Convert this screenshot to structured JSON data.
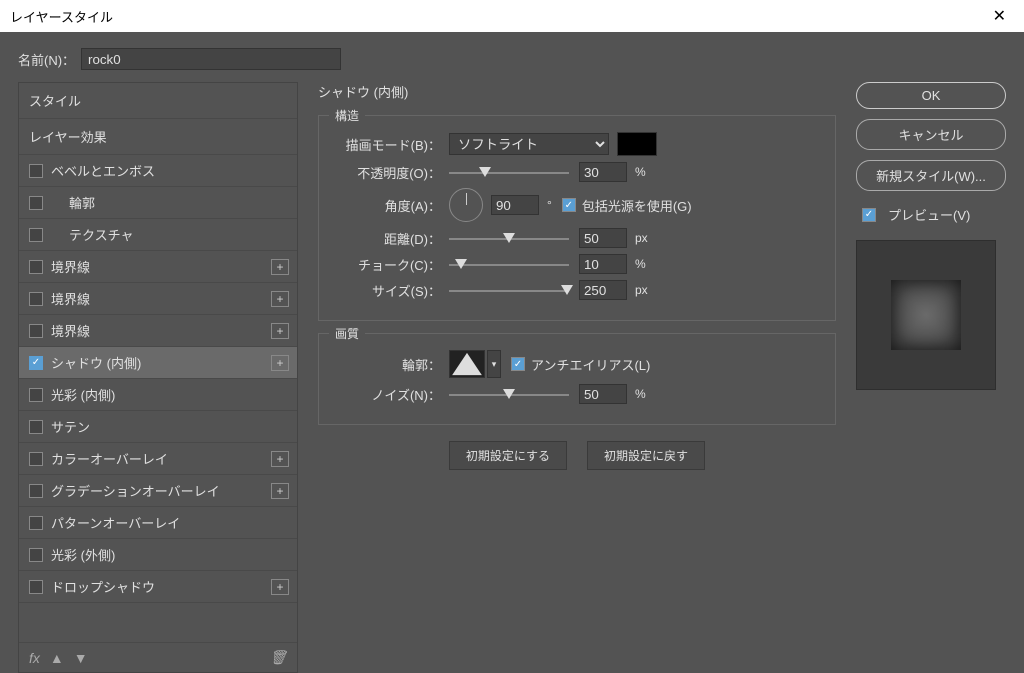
{
  "window": {
    "title": "レイヤースタイル"
  },
  "name": {
    "label": "名前(N)：",
    "value": "rock0"
  },
  "sidebar": {
    "header": "スタイル",
    "subheader": "レイヤー効果",
    "items": [
      {
        "label": "ベベルとエンボス",
        "check": false,
        "plus": false,
        "indent": false
      },
      {
        "label": "輪郭",
        "check": false,
        "plus": false,
        "indent": true
      },
      {
        "label": "テクスチャ",
        "check": false,
        "plus": false,
        "indent": true
      },
      {
        "label": "境界線",
        "check": false,
        "plus": true,
        "indent": false
      },
      {
        "label": "境界線",
        "check": false,
        "plus": true,
        "indent": false
      },
      {
        "label": "境界線",
        "check": false,
        "plus": true,
        "indent": false
      },
      {
        "label": "シャドウ (内側)",
        "check": true,
        "plus": true,
        "indent": false,
        "selected": true
      },
      {
        "label": "光彩 (内側)",
        "check": false,
        "plus": false,
        "indent": false
      },
      {
        "label": "サテン",
        "check": false,
        "plus": false,
        "indent": false
      },
      {
        "label": "カラーオーバーレイ",
        "check": false,
        "plus": true,
        "indent": false
      },
      {
        "label": "グラデーションオーバーレイ",
        "check": false,
        "plus": true,
        "indent": false
      },
      {
        "label": "パターンオーバーレイ",
        "check": false,
        "plus": false,
        "indent": false
      },
      {
        "label": "光彩 (外側)",
        "check": false,
        "plus": false,
        "indent": false
      },
      {
        "label": "ドロップシャドウ",
        "check": false,
        "plus": true,
        "indent": false
      }
    ],
    "footer_fx": "fx"
  },
  "panel": {
    "title": "シャドウ (内側)",
    "structure": {
      "legend": "構造",
      "blend_label": "描画モード(B)：",
      "blend_value": "ソフトライト",
      "color": "#000000",
      "opacity_label": "不透明度(O)：",
      "opacity_value": "30",
      "opacity_unit": "%",
      "angle_label": "角度(A)：",
      "angle_value": "90",
      "angle_unit": "°",
      "global_label": "包括光源を使用(G)",
      "distance_label": "距離(D)：",
      "distance_value": "50",
      "distance_unit": "px",
      "choke_label": "チョーク(C)：",
      "choke_value": "10",
      "choke_unit": "%",
      "size_label": "サイズ(S)：",
      "size_value": "250",
      "size_unit": "px"
    },
    "quality": {
      "legend": "画質",
      "contour_label": "輪郭：",
      "aa_label": "アンチエイリアス(L)",
      "noise_label": "ノイズ(N)：",
      "noise_value": "50",
      "noise_unit": "%"
    },
    "buttons": {
      "make_default": "初期設定にする",
      "reset_default": "初期設定に戻す"
    }
  },
  "right": {
    "ok": "OK",
    "cancel": "キャンセル",
    "newstyle": "新規スタイル(W)...",
    "preview": "プレビュー(V)"
  }
}
